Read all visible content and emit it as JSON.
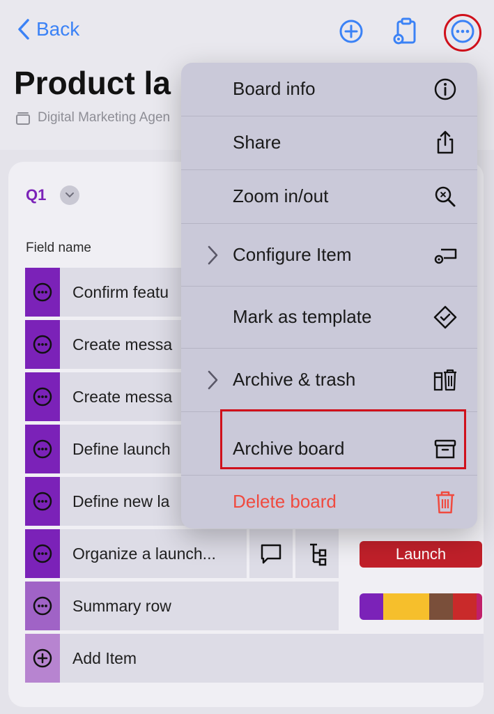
{
  "nav": {
    "back_label": "Back"
  },
  "board": {
    "title": "Product la",
    "workspace": "Digital Marketing Agen"
  },
  "group": {
    "label": "Q1"
  },
  "table": {
    "column_header": "Field name",
    "rows": [
      {
        "name": "Confirm featu"
      },
      {
        "name": "Create messa"
      },
      {
        "name": "Create messa"
      },
      {
        "name": "Define launch"
      },
      {
        "name": "Define new la"
      },
      {
        "name": "Organize a launch...",
        "status": "Launch"
      },
      {
        "name": "Summary row"
      }
    ],
    "add_item_label": "Add Item"
  },
  "menu": {
    "items": [
      {
        "label": "Board info",
        "icon": "info-icon"
      },
      {
        "label": "Share",
        "icon": "share-icon"
      },
      {
        "label": "Zoom in/out",
        "icon": "zoom-icon"
      },
      {
        "label": "Configure Item",
        "icon": "configure-icon",
        "submenu": true
      },
      {
        "label": "Mark as template",
        "icon": "template-icon"
      },
      {
        "label": "Archive & trash",
        "icon": "archive-trash-icon",
        "submenu": true
      },
      {
        "label": "Archive board",
        "icon": "archive-box-icon"
      },
      {
        "label": "Delete board",
        "icon": "trash-icon",
        "destructive": true
      }
    ]
  },
  "colors": {
    "accent_blue": "#3b82f6",
    "group_purple": "#7b22b8",
    "status_launch": "#c0202a",
    "destructive": "#f04a3f",
    "highlight_red": "#d0101b"
  }
}
